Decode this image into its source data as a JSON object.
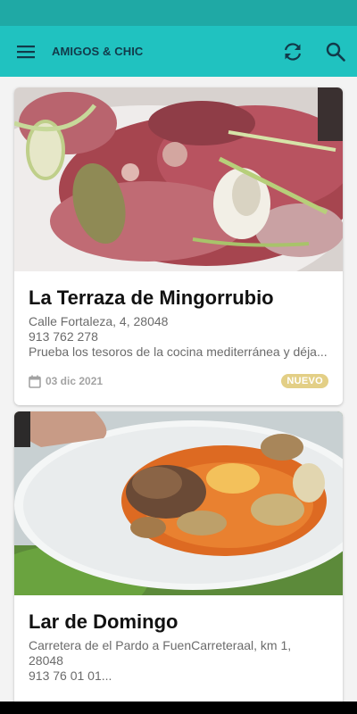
{
  "app_bar": {
    "title": "AMIGOS & CHIC",
    "menu_icon": "menu-icon",
    "refresh_icon": "refresh-icon",
    "search_icon": "search-icon"
  },
  "colors": {
    "status_bar": "#1fa9a5",
    "app_bar": "#20c2c0",
    "badge": "#e3cf86"
  },
  "restaurants": [
    {
      "name": "La Terraza de Mingorrubio",
      "address": "Calle Fortaleza, 4, 28048",
      "phone": "913 762 278",
      "description": "Prueba los tesoros de la cocina mediterránea y déja...",
      "date": "03 dic 2021",
      "badge": "NUEVO",
      "image": "meat-dish-photo"
    },
    {
      "name": "Lar de Domingo",
      "address": "Carretera de el Pardo a FuenCarreteraal, km 1, 28048",
      "phone": "913  76 01 01...",
      "image": "clam-stew-photo"
    }
  ]
}
